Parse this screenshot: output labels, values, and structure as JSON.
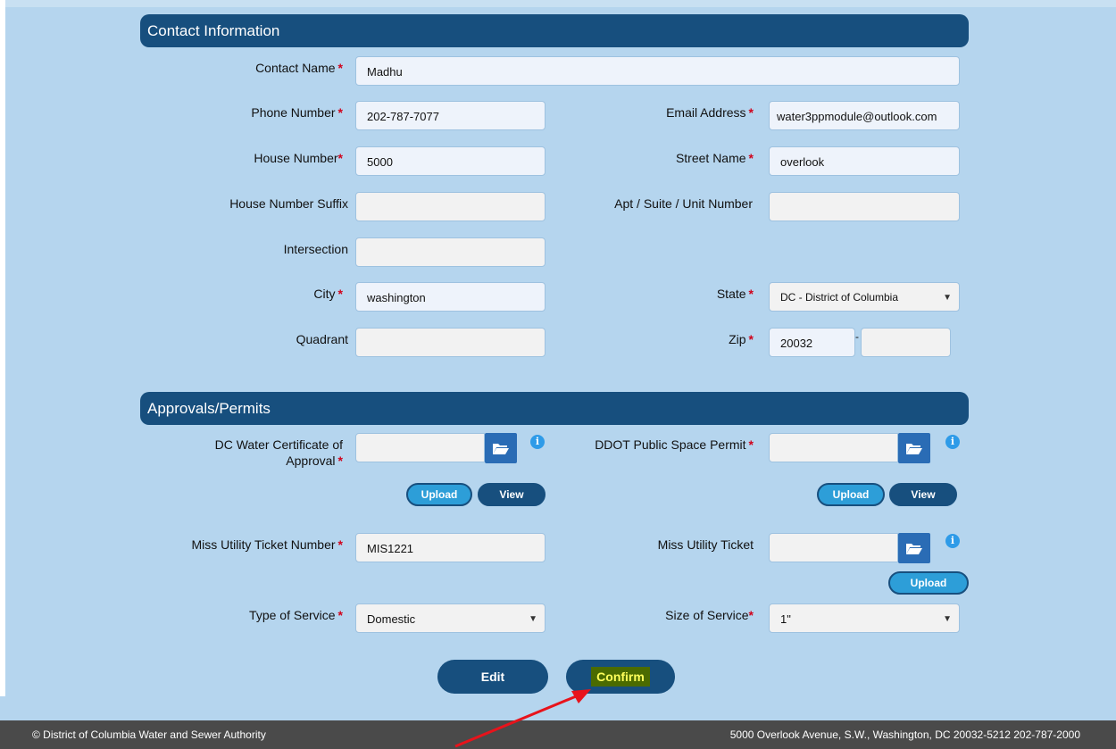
{
  "contact": {
    "header": "Contact Information",
    "contact_name_label": "Contact Name",
    "contact_name_value": "Madhu",
    "phone_label": "Phone Number",
    "phone_value": "202-787-7077",
    "email_label": "Email Address",
    "email_value": "water3ppmodule@outlook.com",
    "house_number_label": "House Number",
    "house_number_value": "5000",
    "street_name_label": "Street Name",
    "street_name_value": "overlook",
    "house_suffix_label": "House Number Suffix",
    "house_suffix_value": "",
    "apt_label": "Apt / Suite / Unit Number",
    "apt_value": "",
    "intersection_label": "Intersection",
    "intersection_value": "",
    "city_label": "City",
    "city_value": "washington",
    "state_label": "State",
    "state_value": "DC - District of Columbia",
    "quadrant_label": "Quadrant",
    "quadrant_value": "",
    "zip_label": "Zip",
    "zip_value": "20032",
    "zip_ext_value": "",
    "zip_sep": "-"
  },
  "approvals": {
    "header": "Approvals/Permits",
    "dcw_cert_label_1": "DC Water Certificate of",
    "dcw_cert_label_2": "Approval",
    "ddot_label": "DDOT Public Space Permit",
    "miss_utility_number_label": "Miss Utility Ticket Number",
    "miss_utility_number_value": "MIS1221",
    "miss_utility_ticket_label": "Miss Utility Ticket",
    "type_of_service_label": "Type of Service",
    "type_of_service_value": "Domestic",
    "size_of_service_label": "Size of Service",
    "size_of_service_value": "1\"",
    "upload_label": "Upload",
    "view_label": "View",
    "info_glyph": "i"
  },
  "required_mark": "*",
  "actions": {
    "edit_label": "Edit",
    "confirm_label": "Confirm"
  },
  "footer": {
    "left": "© District of Columbia Water and Sewer Authority",
    "right": "5000 Overlook Avenue, S.W., Washington, DC 20032-5212 202-787-2000"
  },
  "icons": {
    "folder": "folder-open-icon",
    "info": "info-icon",
    "dropdown": "chevron-down-icon",
    "arrow": "annotation-arrow"
  },
  "colors": {
    "page_bg": "#b5d5ee",
    "header_bg": "#174f7e",
    "upload_btn": "#2d9ed8",
    "required": "#d0021b",
    "annotation": "#e8131b",
    "footer_bg": "#4a4a4a"
  }
}
